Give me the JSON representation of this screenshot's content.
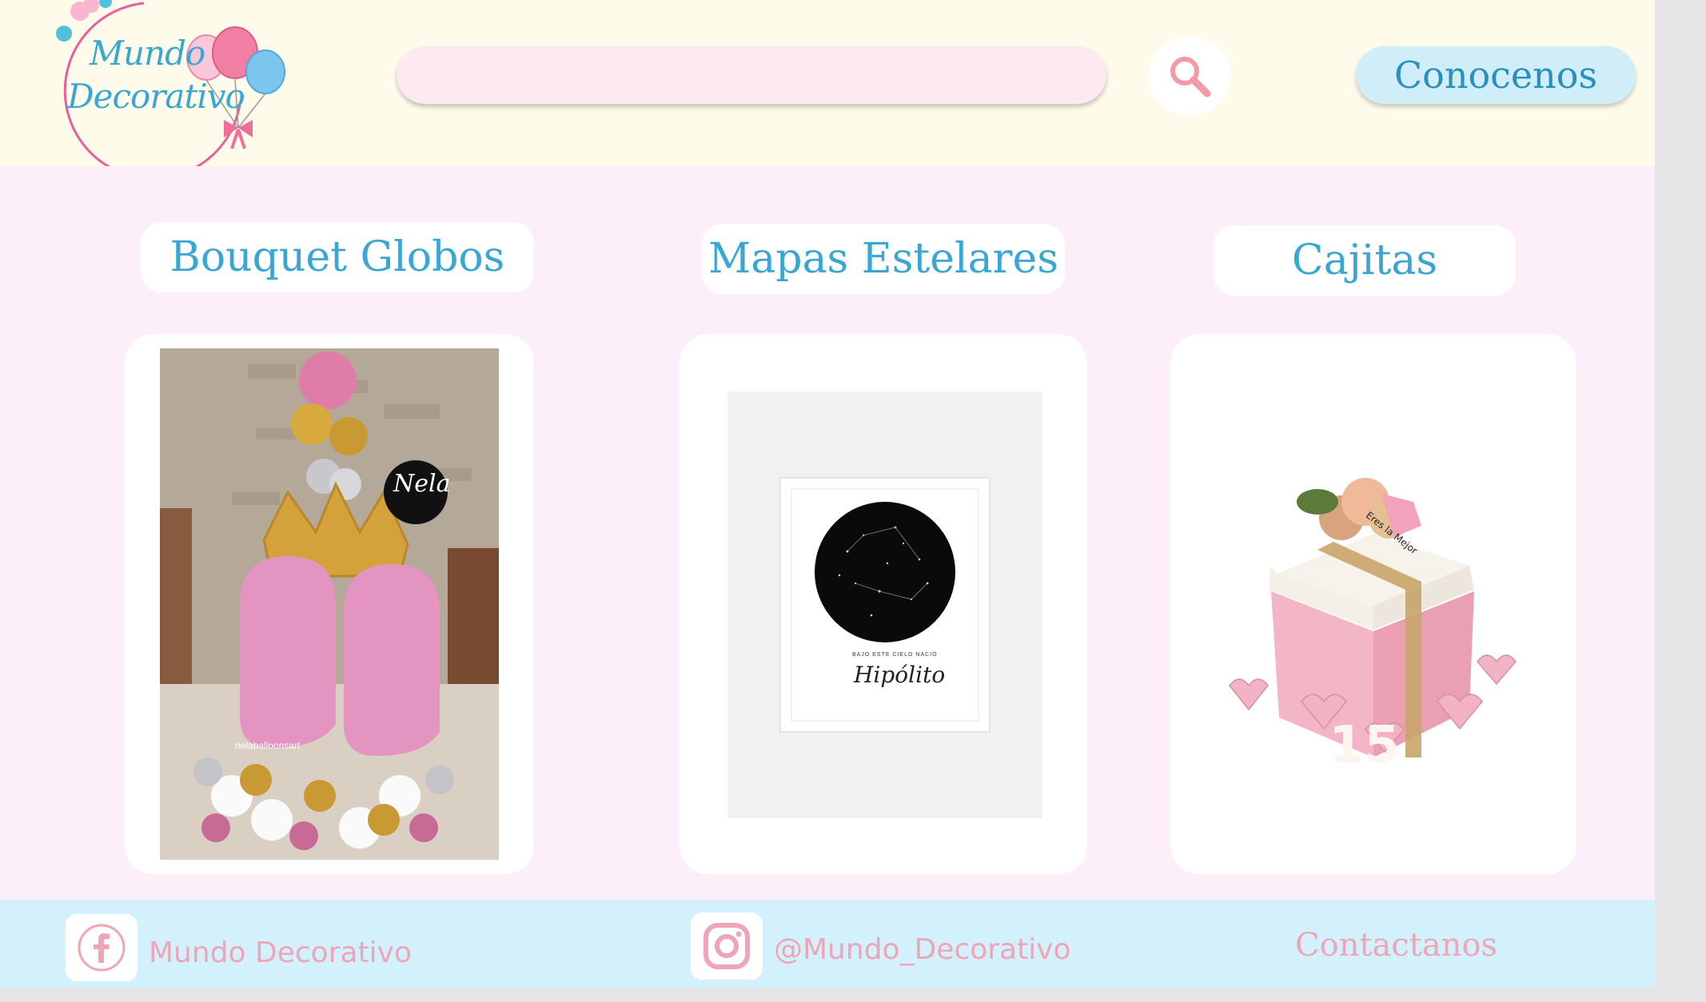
{
  "header": {
    "logo_line1": "Mundo",
    "logo_line2": "Decorativo",
    "search_placeholder": "",
    "about_label": "Conocenos"
  },
  "categories": [
    {
      "title": "Bouquet Globos",
      "image_icon": "balloon-bouquet-photo",
      "photo_label": "nelaballoonsart",
      "photo_logo": "Nela"
    },
    {
      "title": "Mapas Estelares",
      "image_icon": "star-map-poster",
      "poster_caption": "BAJO ESTE CIELO NACIÓ",
      "poster_name": "Hipólito"
    },
    {
      "title": "Cajitas",
      "image_icon": "gift-box-photo",
      "box_number": "15",
      "tag_text": "Eres la Mejor"
    }
  ],
  "footer": {
    "facebook_label": "Mundo Decorativo",
    "instagram_label": "@Mundo_Decorativo",
    "contact_label": "Contactanos"
  },
  "colors": {
    "header_bg": "#fefbea",
    "main_bg": "#fdeff9",
    "footer_bg": "#d3f1fc",
    "accent_blue": "#3aa6d3",
    "accent_pink": "#eea5b6"
  }
}
